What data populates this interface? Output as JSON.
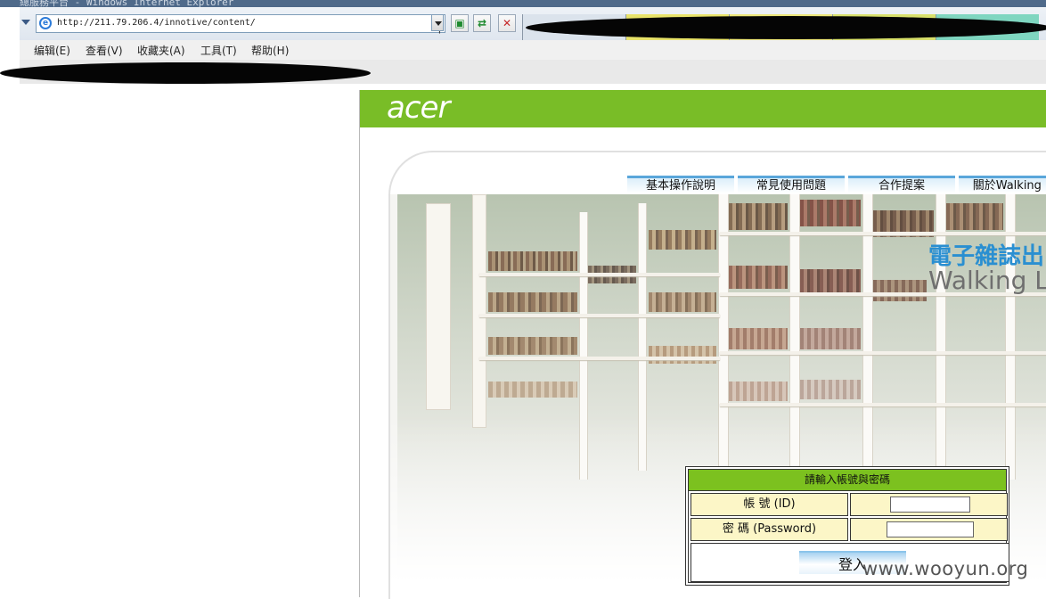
{
  "browser": {
    "window_title": "總服務平台 - Windows Internet Explorer",
    "address": "http://211.79.206.4/innotive/content/",
    "menu": [
      "编辑(E)",
      "查看(V)",
      "收藏夹(A)",
      "工具(T)",
      "帮助(H)"
    ]
  },
  "site": {
    "logo": "acer",
    "nav_tabs": [
      "基本操作說明",
      "常見使用問題",
      "合作提案",
      "關於Walking L"
    ],
    "hero_title_cn": "電子雜誌出",
    "hero_title_en": "Walking L"
  },
  "login": {
    "header": "請輸入帳號與密碼",
    "id_label": "帳 號 (ID)",
    "id_value": "",
    "password_label": "密 碼 (Password)",
    "password_value": "",
    "submit_label": "登入"
  },
  "watermark": "www.wooyun.org",
  "colors": {
    "acer_green": "#79bd27",
    "login_header_green": "#7cc11f",
    "login_cell_yellow": "#fcf6c7",
    "title_blue": "#2a8fd1"
  }
}
